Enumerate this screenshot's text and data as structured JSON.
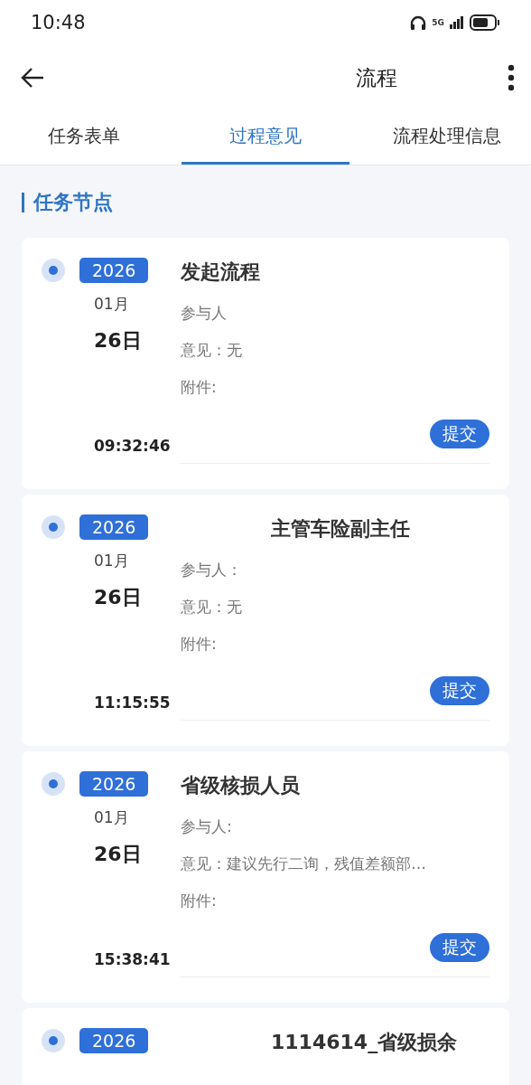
{
  "status_bar": {
    "time": "10:48",
    "network": "5G"
  },
  "header": {
    "title": "流程",
    "redacted": true
  },
  "tabs": [
    {
      "label": "任务表单",
      "selected": false
    },
    {
      "label": "过程意见",
      "selected": true
    },
    {
      "label": "流程处理信息",
      "selected": false
    }
  ],
  "section_title": "任务节点",
  "nodes": [
    {
      "year": "2026",
      "month": "01月",
      "day": "26日",
      "time": "09:32:46",
      "title": "发起流程",
      "title_redacted": false,
      "participants": "参与人",
      "opinion": "意见：无",
      "attachments": "附件:",
      "action": "提交"
    },
    {
      "year": "2026",
      "month": "01月",
      "day": "26日",
      "time": "11:15:55",
      "title": "主管车险副主任",
      "title_redacted": true,
      "participants": "参与人：",
      "opinion": "意见：无",
      "attachments": "附件:",
      "action": "提交"
    },
    {
      "year": "2026",
      "month": "01月",
      "day": "26日",
      "time": "15:38:41",
      "title": "省级核损人员",
      "title_redacted": false,
      "participants": "参与人:",
      "opinion": "意见：建议先行二询，残值差额部…",
      "attachments": "附件:",
      "action": "提交"
    },
    {
      "year": "2026",
      "title": "1114614_省级损余",
      "title_redacted": true
    }
  ]
}
